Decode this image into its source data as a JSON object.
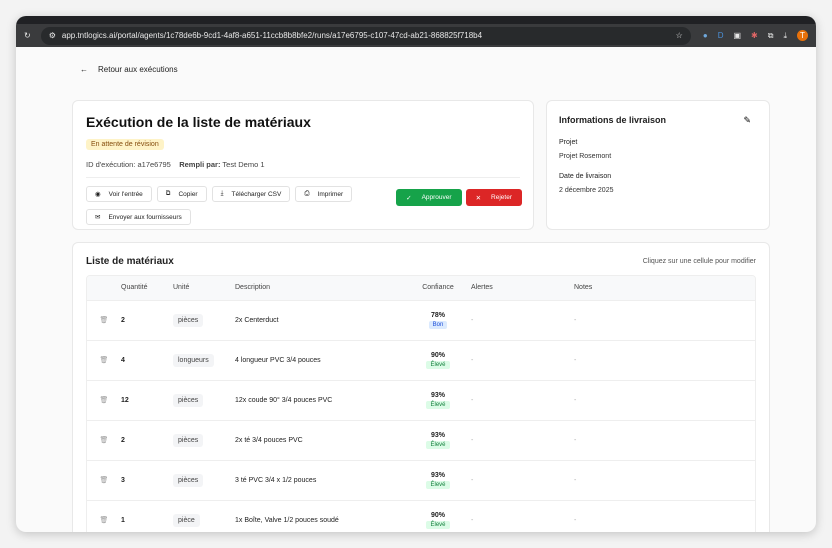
{
  "browser": {
    "url": "app.tntlogics.ai/portal/agents/1c78de6b-9cd1-4af8-a651-11ccb8b8bfe2/runs/a17e6795-c107-47cd-ab21-868825f718b4",
    "avatar": "T"
  },
  "back_label": "Retour aux exécutions",
  "run": {
    "title": "Exécution de la liste de matériaux",
    "status": "En attente de révision",
    "id_label": "ID d'exécution:",
    "id": "a17e6795",
    "filled_label": "Rempli par:",
    "filled_by": "Test Demo 1",
    "actions": {
      "view": "Voir l'entrée",
      "copy": "Copier",
      "csv": "Télécharger CSV",
      "print": "Imprimer",
      "send": "Envoyer aux fournisseurs",
      "approve": "Approuver",
      "reject": "Rejeter"
    }
  },
  "delivery": {
    "title": "Informations de livraison",
    "project_label": "Projet",
    "project": "Projet Rosemont",
    "date_label": "Date de livraison",
    "date": "2 décembre 2025"
  },
  "materials": {
    "title": "Liste de matériaux",
    "hint": "Cliquez sur une cellule pour modifier",
    "columns": [
      "Quantité",
      "Unité",
      "Description",
      "Confiance",
      "Alertes",
      "Notes"
    ],
    "rows": [
      {
        "qty": "2",
        "unit": "pièces",
        "desc": "2x Centerduct",
        "conf": "78%",
        "level": "Bon",
        "alerts": "-",
        "notes": "-"
      },
      {
        "qty": "4",
        "unit": "longueurs",
        "desc": "4 longueur PVC 3/4 pouces",
        "conf": "90%",
        "level": "Élevé",
        "alerts": "-",
        "notes": "-"
      },
      {
        "qty": "12",
        "unit": "pièces",
        "desc": "12x coude 90° 3/4 pouces PVC",
        "conf": "93%",
        "level": "Élevé",
        "alerts": "-",
        "notes": "-"
      },
      {
        "qty": "2",
        "unit": "pièces",
        "desc": "2x té 3/4 pouces PVC",
        "conf": "93%",
        "level": "Élevé",
        "alerts": "-",
        "notes": "-"
      },
      {
        "qty": "3",
        "unit": "pièces",
        "desc": "3 té PVC 3/4 x 1/2 pouces",
        "conf": "93%",
        "level": "Élevé",
        "alerts": "-",
        "notes": "-"
      },
      {
        "qty": "1",
        "unit": "pièce",
        "desc": "1x Boîte, Valve 1/2 pouces soudé",
        "conf": "90%",
        "level": "Élevé",
        "alerts": "-",
        "notes": "-"
      }
    ]
  },
  "colors": {
    "approve": "#16a34a",
    "reject": "#dc2626",
    "good": "#dbeafe",
    "high": "#dcfce7"
  }
}
